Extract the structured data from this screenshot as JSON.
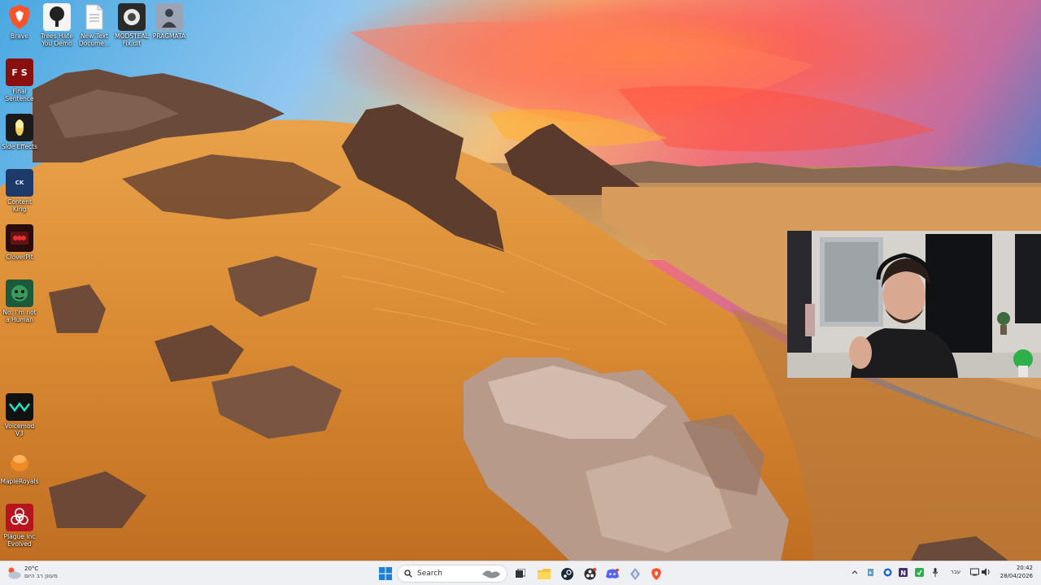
{
  "desktop": {
    "icons": [
      {
        "label": "Brave",
        "icon": "brave-icon"
      },
      {
        "label": "Trees Hate You Demo",
        "icon": "tree-icon"
      },
      {
        "label": "New Text Docume...",
        "icon": "text-document-icon"
      },
      {
        "label": "MODSTEAL Fix.dlt",
        "icon": "mod-file-icon"
      },
      {
        "label": "PRAGMATA",
        "icon": "pragmata-icon"
      },
      {
        "label": "Final Sentence",
        "icon": "final-sentence-icon"
      },
      {
        "label": "Side Effects",
        "icon": "side-effects-icon"
      },
      {
        "label": "Content King",
        "icon": "content-king-icon"
      },
      {
        "label": "CloverPit",
        "icon": "cloverpit-icon"
      },
      {
        "label": "No, I'm not a Human",
        "icon": "not-human-icon"
      },
      {
        "label": "Voicemod V3",
        "icon": "voicemod-icon"
      },
      {
        "label": "MapleRoyals",
        "icon": "mapleroyals-icon"
      },
      {
        "label": "Plague Inc Evolved",
        "icon": "plague-inc-icon"
      }
    ]
  },
  "taskbar": {
    "weather": {
      "temp": "20°C",
      "condition": "מעונן רב היום"
    },
    "search_placeholder": "Search",
    "language": "עבר",
    "time": "20:42",
    "date": "28/04/2026"
  },
  "colors": {
    "taskbar_bg": "#eef0f3",
    "accent": "#0067c0"
  }
}
